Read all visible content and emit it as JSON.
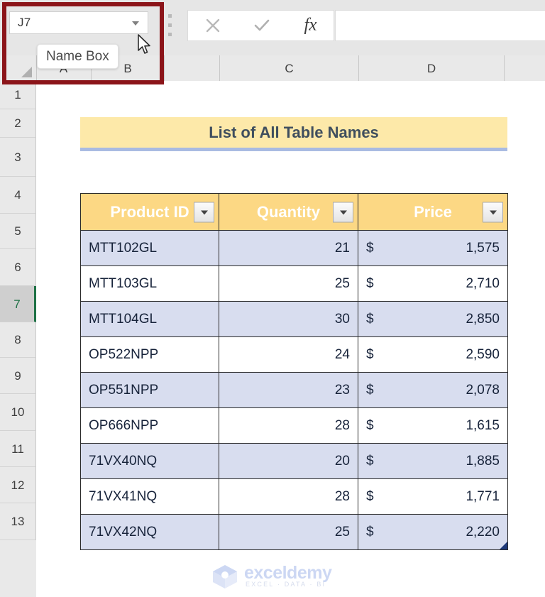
{
  "namebox": {
    "value": "J7",
    "dropdown_icon": "chevron-down-icon",
    "tooltip": "Name Box"
  },
  "formula_bar": {
    "cancel_icon": "cancel-x-icon",
    "enter_icon": "check-icon",
    "function_icon": "fx-icon",
    "fx_label": "fx",
    "value": ""
  },
  "columns": [
    "A",
    "B",
    "C",
    "D"
  ],
  "rows": [
    "1",
    "2",
    "3",
    "4",
    "5",
    "6",
    "7",
    "8",
    "9",
    "10",
    "11",
    "12",
    "13"
  ],
  "selected_row": "7",
  "banner": {
    "title": "List of All Table Names"
  },
  "table": {
    "headers": [
      "Product ID",
      "Quantity",
      "Price"
    ],
    "filter_icon": "filter-dropdown-icon",
    "currency_symbol": "$",
    "rows": [
      {
        "product_id": "MTT102GL",
        "quantity": "21",
        "price": "1,575"
      },
      {
        "product_id": "MTT103GL",
        "quantity": "25",
        "price": "2,710"
      },
      {
        "product_id": "MTT104GL",
        "quantity": "30",
        "price": "2,850"
      },
      {
        "product_id": "OP522NPP",
        "quantity": "24",
        "price": "2,590"
      },
      {
        "product_id": "OP551NPP",
        "quantity": "23",
        "price": "2,078"
      },
      {
        "product_id": "OP666NPP",
        "quantity": "28",
        "price": "1,615"
      },
      {
        "product_id": "71VX40NQ",
        "quantity": "20",
        "price": "1,885"
      },
      {
        "product_id": "71VX41NQ",
        "quantity": "28",
        "price": "1,771"
      },
      {
        "product_id": "71VX42NQ",
        "quantity": "25",
        "price": "2,220"
      }
    ]
  },
  "watermark": {
    "word": "exceldemy",
    "tagline": "EXCEL · DATA · BI"
  },
  "colors": {
    "banner_fill": "#fde9a9",
    "header_fill": "#fcd884",
    "band_fill": "#d8ddef",
    "annotation": "#8b1419",
    "selection_accent": "#1e7145"
  }
}
